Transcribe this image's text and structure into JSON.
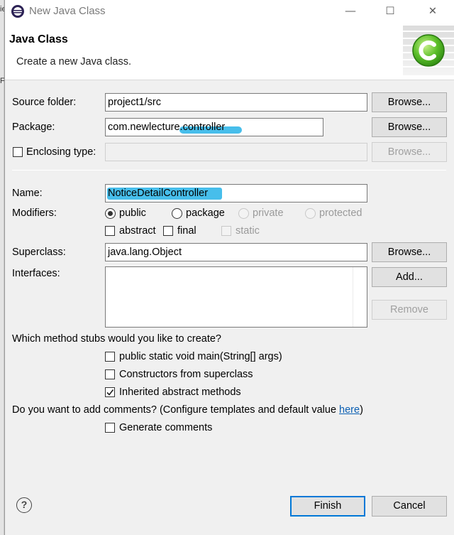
{
  "window": {
    "title": "New Java Class",
    "controls": [
      "—",
      "☐",
      "✕"
    ]
  },
  "banner": {
    "title": "Java Class",
    "subtitle": "Create a new Java class."
  },
  "form": {
    "source_folder": {
      "label": "Source folder:",
      "value": "project1/src",
      "button": "Browse..."
    },
    "package": {
      "label": "Package:",
      "value": "com.newlecture.controller",
      "button": "Browse..."
    },
    "enclosing_type": {
      "label": "Enclosing type:",
      "value": "",
      "button": "Browse...",
      "checked": false
    },
    "name": {
      "label": "Name:",
      "value": "NoticeDetailController"
    },
    "modifiers": {
      "label": "Modifiers:",
      "public": "public",
      "package": "package",
      "private": "private",
      "protected": "protected",
      "abstract": "abstract",
      "final": "final",
      "static": "static",
      "selected": "public"
    },
    "superclass": {
      "label": "Superclass:",
      "value": "java.lang.Object",
      "button": "Browse..."
    },
    "interfaces": {
      "label": "Interfaces:",
      "add_button": "Add...",
      "remove_button": "Remove"
    }
  },
  "stubs": {
    "question": "Which method stubs would you like to create?",
    "main": {
      "label": "public static void main(String[] args)",
      "checked": false
    },
    "constructors": {
      "label": "Constructors from superclass",
      "checked": false
    },
    "inherited": {
      "label": "Inherited abstract methods",
      "checked": true
    }
  },
  "comments": {
    "question": "Do you want to add comments? (Configure templates and default value ",
    "link": "here",
    "question_end": ")",
    "generate": {
      "label": "Generate comments",
      "checked": false
    }
  },
  "footer": {
    "help_icon": "?",
    "finish": "Finish",
    "cancel": "Cancel"
  },
  "background_fragments": [
    "ie",
    "Fi"
  ],
  "colors": {
    "highlight": "#27b3e8",
    "link": "#0b5fb3",
    "primary_border": "#0078d7",
    "icon_green": "#5cbf2a"
  }
}
